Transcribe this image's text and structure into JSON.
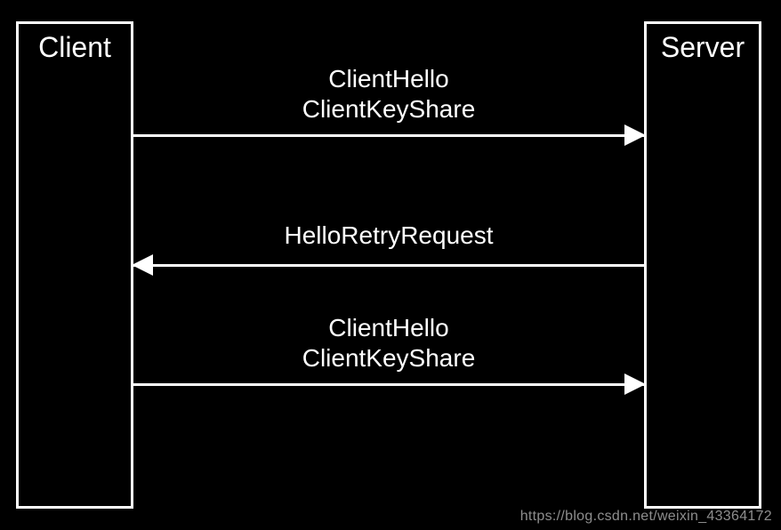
{
  "participants": {
    "client": "Client",
    "server": "Server"
  },
  "messages": {
    "m1_line1": "ClientHello",
    "m1_line2": "ClientKeyShare",
    "m2_line1": "HelloRetryRequest",
    "m3_line1": "ClientHello",
    "m3_line2": "ClientKeyShare"
  },
  "watermark": "https://blog.csdn.net/weixin_43364172"
}
